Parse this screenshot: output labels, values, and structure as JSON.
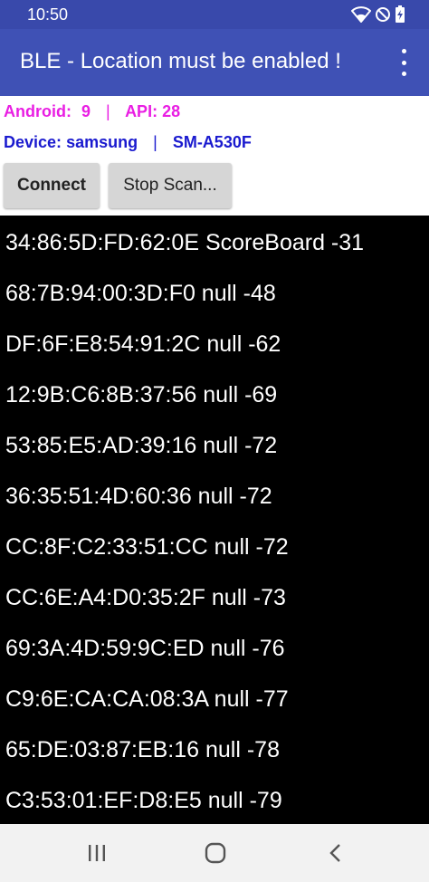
{
  "status_bar": {
    "time": "10:50",
    "icons": [
      "wifi-icon",
      "do-not-disturb-icon",
      "battery-charging-icon"
    ]
  },
  "app_bar": {
    "title": "BLE - Location must be enabled !",
    "menu_icon": "more-vert-icon"
  },
  "info": {
    "android_label": "Android:",
    "android_version": "9",
    "api_label": "API:",
    "api_level": "28",
    "device_label": "Device:",
    "device_maker": "samsung",
    "device_model": "SM-A530F",
    "separator": "|"
  },
  "buttons": {
    "connect": "Connect",
    "stop_scan": "Stop Scan..."
  },
  "devices": [
    "34:86:5D:FD:62:0E ScoreBoard -31",
    "68:7B:94:00:3D:F0 null -48",
    "DF:6F:E8:54:91:2C null -62",
    "12:9B:C6:8B:37:56 null -69",
    "53:85:E5:AD:39:16 null -72",
    "36:35:51:4D:60:36 null -72",
    "CC:8F:C2:33:51:CC null -72",
    "CC:6E:A4:D0:35:2F null -73",
    "69:3A:4D:59:9C:ED null -76",
    "C9:6E:CA:CA:08:3A null -77",
    "65:DE:03:87:EB:16 null -78",
    "C3:53:01:EF:D8:E5 null -79"
  ],
  "nav_bar": {
    "icons": [
      "recents-icon",
      "home-icon",
      "back-icon"
    ]
  },
  "colors": {
    "status_bar": "#3949ab",
    "app_bar": "#3f51b5",
    "android_text": "#e91ee3",
    "device_text": "#1a1acf",
    "list_background": "#000000",
    "list_text": "#ffffff"
  }
}
